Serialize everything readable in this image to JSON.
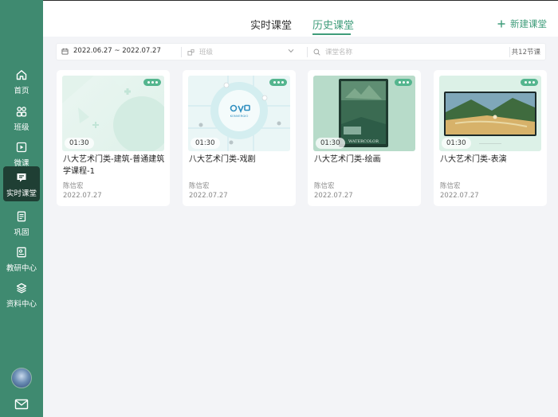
{
  "sidebar": {
    "items": [
      {
        "label": "首页",
        "icon": "home-icon"
      },
      {
        "label": "班级",
        "icon": "users-icon"
      },
      {
        "label": "微课",
        "icon": "play-icon"
      },
      {
        "label": "实时课堂",
        "icon": "chat-icon"
      },
      {
        "label": "巩固",
        "icon": "document-icon"
      },
      {
        "label": "教研中心",
        "icon": "research-icon"
      },
      {
        "label": "资料中心",
        "icon": "layers-icon"
      }
    ],
    "active_index": 3
  },
  "header": {
    "tabs": [
      {
        "label": "实时课堂"
      },
      {
        "label": "历史课堂"
      }
    ],
    "active_tab": 1,
    "new_button": "新建课堂"
  },
  "filters": {
    "date_range": "2022.06.27 ~ 2022.07.27",
    "class_placeholder": "班级",
    "search_placeholder": "课堂名称",
    "count_text": "共12节课"
  },
  "courses": [
    {
      "title": "八大艺术门类-建筑-普通建筑学课程-1",
      "duration": "01:30",
      "teacher": "陈信宏",
      "date": "2022.07.27"
    },
    {
      "title": "八大艺术门类-戏剧",
      "duration": "01:30",
      "teacher": "陈信宏",
      "date": "2022.07.27",
      "logo_text": "KONVERGIO"
    },
    {
      "title": "八大艺术门类-绘画",
      "duration": "01:30",
      "teacher": "陈信宏",
      "date": "2022.07.27",
      "poster_text": "WATERCOLOR"
    },
    {
      "title": "八大艺术门类-表演",
      "duration": "01:30",
      "teacher": "陈信宏",
      "date": "2022.07.27"
    }
  ],
  "colors": {
    "sidebar": "#3f8a70",
    "sidebar_active": "#1f3f34",
    "accent": "#3f9c7a",
    "background": "#f3f4f7"
  }
}
